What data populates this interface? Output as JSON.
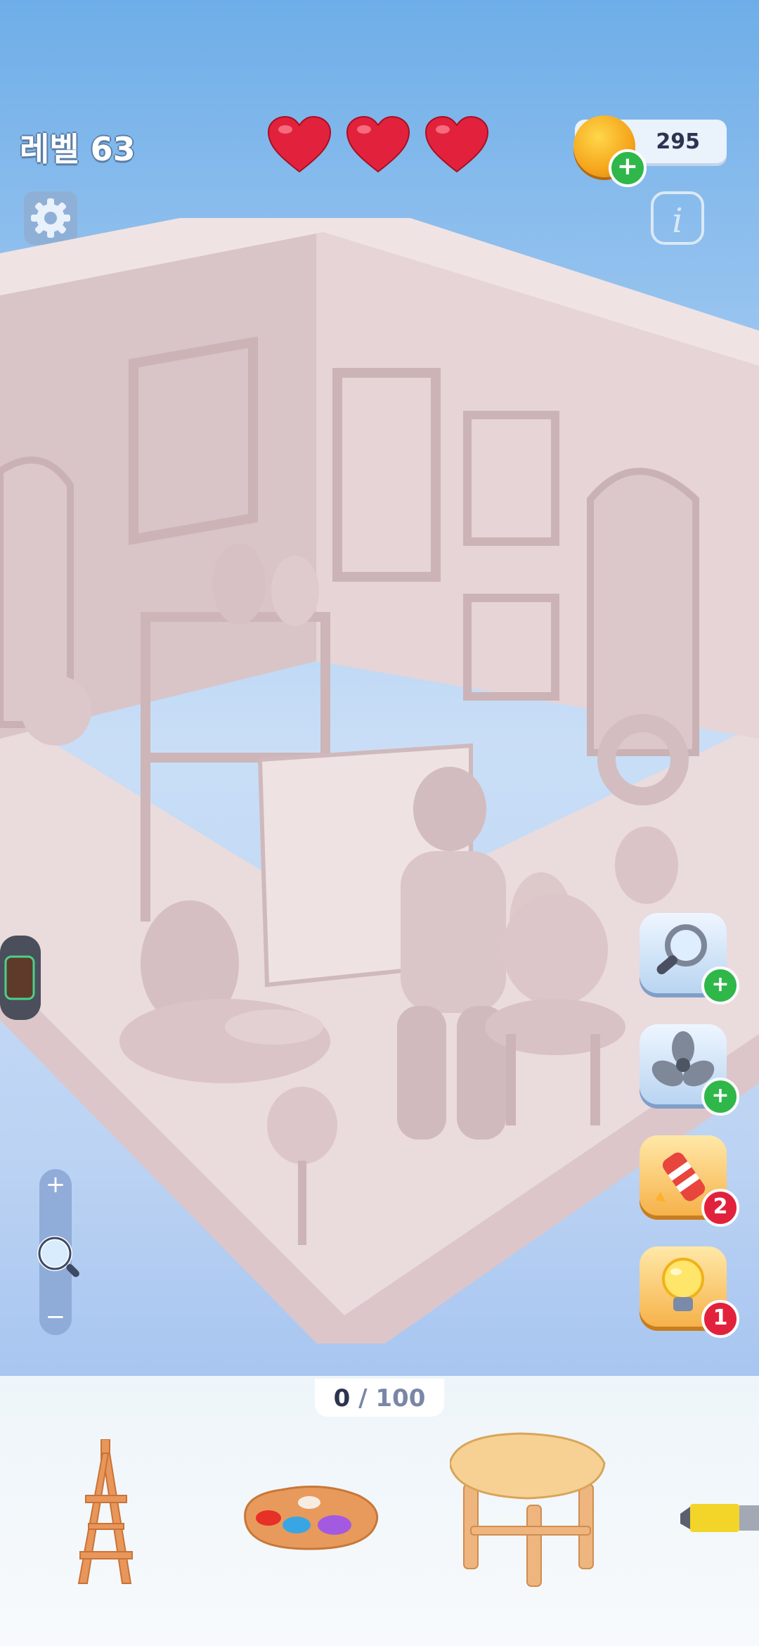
{
  "hud": {
    "level_label": "레벨 63",
    "hearts": 3,
    "coins": "295"
  },
  "icons": {
    "settings": "gear-icon",
    "info": "info-icon",
    "coin": "coin-icon",
    "zoom": "magnifier-icon"
  },
  "boosters": [
    {
      "name": "magnifier",
      "badge": "+",
      "style": "blue"
    },
    {
      "name": "fan",
      "badge": "+",
      "style": "blue"
    },
    {
      "name": "firework-rocket",
      "badge": "2",
      "style": "gold"
    },
    {
      "name": "light-bulb",
      "badge": "1",
      "style": "gold"
    }
  ],
  "zoom": {
    "plus": "+",
    "minus": "−"
  },
  "progress": {
    "found": "0",
    "separator": "/",
    "total": "100"
  },
  "tray_items": [
    "easel",
    "palette",
    "stool",
    "paint-tube"
  ],
  "colors": {
    "heart": "#e2223c",
    "coin": "#f5a61c",
    "green_badge": "#2fb74a",
    "red_badge": "#e2223c",
    "room": "#ead9db"
  }
}
